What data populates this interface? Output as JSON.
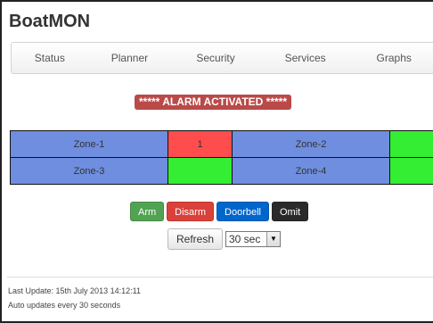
{
  "app": {
    "title": "BoatMON"
  },
  "nav": {
    "items": [
      {
        "label": "Status"
      },
      {
        "label": "Planner"
      },
      {
        "label": "Security"
      },
      {
        "label": "Services"
      },
      {
        "label": "Graphs"
      }
    ]
  },
  "alarm": {
    "text": "***** ALARM ACTIVATED *****",
    "color": "#b94a48"
  },
  "zones": {
    "rows": [
      [
        {
          "name": "Zone-1",
          "status": "1",
          "state": "alarm"
        },
        {
          "name": "Zone-2",
          "status": "",
          "state": "ok"
        }
      ],
      [
        {
          "name": "Zone-3",
          "status": "",
          "state": "ok"
        },
        {
          "name": "Zone-4",
          "status": "",
          "state": "ok"
        }
      ]
    ],
    "colors": {
      "name": "#6f8edf",
      "alarm": "#ff4d4d",
      "ok": "#33ee33"
    }
  },
  "actions": {
    "arm": "Arm",
    "disarm": "Disarm",
    "doorbell": "Doorbell",
    "omit": "Omit"
  },
  "refresh": {
    "label": "Refresh",
    "interval_value": "30 sec"
  },
  "footer": {
    "last_update": "Last Update: 15th July 2013 14:12:11",
    "auto_update": "Auto updates every 30 seconds"
  }
}
